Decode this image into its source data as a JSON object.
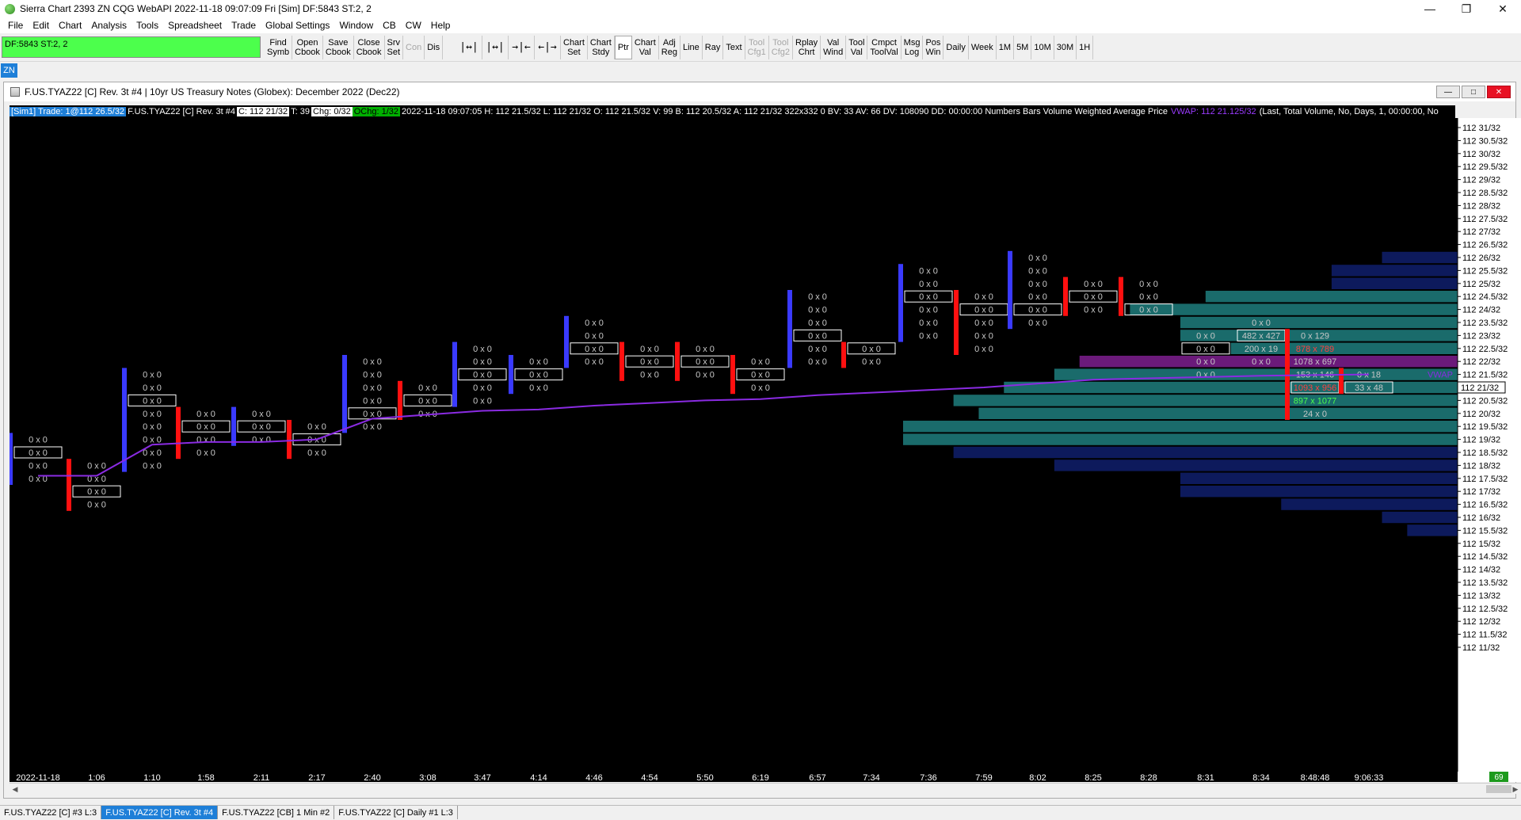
{
  "window": {
    "title": "Sierra Chart 2393 ZN  CQG WebAPI 2022-11-18  09:07:09 Fri [Sim]  DF:5843  ST:2, 2",
    "minimize": "—",
    "maximize": "❐",
    "close": "✕"
  },
  "menu": [
    "File",
    "Edit",
    "Chart",
    "Analysis",
    "Tools",
    "Spreadsheet",
    "Trade",
    "Global Settings",
    "Window",
    "CB",
    "CW",
    "Help"
  ],
  "toolbar": {
    "status": "DF:5843  ST:2, 2",
    "group1": [
      {
        "l1": "Find",
        "l2": "Symb",
        "disabled": false
      },
      {
        "l1": "Open",
        "l2": "Cbook",
        "disabled": false
      },
      {
        "l1": "Save",
        "l2": "Cbook",
        "disabled": false
      },
      {
        "l1": "Close",
        "l2": "Cbook",
        "disabled": false
      },
      {
        "l1": "Srv",
        "l2": "Set",
        "disabled": false
      },
      {
        "l1": "Con",
        "l2": "",
        "disabled": true
      },
      {
        "l1": "Dis",
        "l2": "",
        "disabled": false
      }
    ],
    "icons": [
      "|↔|",
      "|↔|",
      "→|←",
      "←|→"
    ],
    "group2": [
      {
        "l1": "Chart",
        "l2": "Set",
        "disabled": false
      },
      {
        "l1": "Chart",
        "l2": "Stdy",
        "disabled": false
      },
      {
        "l1": "Ptr",
        "l2": "",
        "disabled": false,
        "pressed": true
      },
      {
        "l1": "Chart",
        "l2": "Val",
        "disabled": false
      },
      {
        "l1": "Adj",
        "l2": "Reg",
        "disabled": false
      },
      {
        "l1": "Line",
        "l2": "",
        "disabled": false
      },
      {
        "l1": "Ray",
        "l2": "",
        "disabled": false
      },
      {
        "l1": "Text",
        "l2": "",
        "disabled": false
      },
      {
        "l1": "Tool",
        "l2": "Cfg1",
        "disabled": true
      },
      {
        "l1": "Tool",
        "l2": "Cfg2",
        "disabled": true
      },
      {
        "l1": "Rplay",
        "l2": "Chrt",
        "disabled": false
      },
      {
        "l1": "Val",
        "l2": "Wind",
        "disabled": false
      },
      {
        "l1": "Tool",
        "l2": "Val",
        "disabled": false
      },
      {
        "l1": "Cmpct",
        "l2": "ToolVal",
        "disabled": false
      },
      {
        "l1": "Msg",
        "l2": "Log",
        "disabled": false
      },
      {
        "l1": "Pos",
        "l2": "Win",
        "disabled": false
      },
      {
        "l1": "Daily",
        "l2": "",
        "disabled": false
      },
      {
        "l1": "Week",
        "l2": "",
        "disabled": false
      },
      {
        "l1": "1M",
        "l2": "",
        "disabled": false
      },
      {
        "l1": "5M",
        "l2": "",
        "disabled": false
      },
      {
        "l1": "10M",
        "l2": "",
        "disabled": false
      },
      {
        "l1": "30M",
        "l2": "",
        "disabled": false
      },
      {
        "l1": "1H",
        "l2": "",
        "disabled": false
      }
    ]
  },
  "symbol_tab": "ZN",
  "chart_window": {
    "title": "F.US.TYAZ22 [C]  Rev. 3t  #4 | 10yr US Treasury Notes (Globex): December 2022 (Dec22)",
    "min": "—",
    "max": "□",
    "close": "✕"
  },
  "info_bar": {
    "sim": "[Sim1]  Trade: 1@112 26.5/32",
    "sym": "F.US.TYAZ22 [C]  Rev. 3t  #4",
    "close": "C: 112 21/32",
    "t": "T: 39",
    "chg": "Chg: 0/32",
    "ochg": "OChg: 1/32",
    "rest": "2022-11-18 09:07:05  H: 112 21.5/32  L: 112 21/32  O: 112 21.5/32  V: 99  B: 112 20.5/32  A: 112 21/32  322x332  0  BV: 33  AV: 66  DV: 108090  DD: 00:00:00  Numbers Bars  Volume Weighted Average Price",
    "vwap": "VWAP: 112 21.125/32",
    "tail": "(Last, Total Volume, No, Days, 1, 00:00:00, No"
  },
  "colors": {
    "bg": "#000000",
    "up": "#3a3aff",
    "down": "#ff1010",
    "cell_text": "#c8c8c8",
    "box": "#ffffff",
    "vwap": "#8a2be2",
    "profile_blue": "#0d1a5c",
    "profile_teal": "#1a6b6b",
    "profile_poc": "#6b1a7a"
  },
  "chart_data": {
    "type": "numbers-bars",
    "y_labels": [
      "112 31/32",
      "112 30.5/32",
      "112 30/32",
      "112 29.5/32",
      "112 29/32",
      "112 28.5/32",
      "112 28/32",
      "112 27.5/32",
      "112 27/32",
      "112 26.5/32",
      "112 26/32",
      "112 25.5/32",
      "112 25/32",
      "112 24.5/32",
      "112 24/32",
      "112 23.5/32",
      "112 23/32",
      "112 22.5/32",
      "112 22/32",
      "112 21.5/32",
      "112 21/32",
      "112 20.5/32",
      "112 20/32",
      "112 19.5/32",
      "112 19/32",
      "112 18.5/32",
      "112 18/32",
      "112 17.5/32",
      "112 17/32",
      "112 16.5/32",
      "112 16/32",
      "112 15.5/32",
      "112 15/32",
      "112 14.5/32",
      "112 14/32",
      "112 13.5/32",
      "112 13/32",
      "112 12.5/32",
      "112 12/32",
      "112 11.5/32",
      "112 11/32"
    ],
    "current_price_label": "112 21/32",
    "vwap_label": "VWAP",
    "x_labels": [
      "2022-11-18",
      "1:06",
      "1:10",
      "1:58",
      "2:11",
      "2:17",
      "2:40",
      "3:08",
      "3:47",
      "4:14",
      "4:46",
      "4:54",
      "5:50",
      "6:19",
      "6:57",
      "7:34",
      "7:36",
      "7:59",
      "8:02",
      "8:25",
      "8:28",
      "8:31",
      "8:34",
      "8:48:48",
      "9:06:33"
    ],
    "cell_text": "0 x 0",
    "bars": [
      {
        "x": "2022-11-18",
        "high": 16,
        "low": 13,
        "box": 15,
        "dir": "up"
      },
      {
        "x": "1:06",
        "high": 14,
        "low": 11,
        "box": 12,
        "dir": "down"
      },
      {
        "x": "1:10",
        "high": 21,
        "low": 14,
        "box": 19,
        "dir": "up"
      },
      {
        "x": "1:58",
        "high": 18,
        "low": 15,
        "box": 17,
        "dir": "down"
      },
      {
        "x": "2:11",
        "high": 18,
        "low": 16,
        "box": 17,
        "dir": "up"
      },
      {
        "x": "2:17",
        "high": 17,
        "low": 15,
        "box": 16,
        "dir": "down"
      },
      {
        "x": "2:40",
        "high": 22,
        "low": 17,
        "box": 18,
        "dir": "up"
      },
      {
        "x": "3:08",
        "high": 20,
        "low": 18,
        "box": 19,
        "dir": "down"
      },
      {
        "x": "3:47",
        "high": 23,
        "low": 19,
        "box": 21,
        "dir": "up"
      },
      {
        "x": "4:14",
        "high": 22,
        "low": 20,
        "box": 21,
        "dir": "up"
      },
      {
        "x": "4:46",
        "high": 25,
        "low": 22,
        "box": 23,
        "dir": "up"
      },
      {
        "x": "4:54",
        "high": 23,
        "low": 21,
        "box": 22,
        "dir": "down"
      },
      {
        "x": "5:50",
        "high": 23,
        "low": 21,
        "box": 22,
        "dir": "down"
      },
      {
        "x": "6:19",
        "high": 22,
        "low": 20,
        "box": 21,
        "dir": "down"
      },
      {
        "x": "6:57",
        "high": 27,
        "low": 22,
        "box": 24,
        "dir": "up"
      },
      {
        "x": "7:34",
        "high": 23,
        "low": 22,
        "box": 23,
        "dir": "down"
      },
      {
        "x": "7:36",
        "high": 29,
        "low": 24,
        "box": 27,
        "dir": "up"
      },
      {
        "x": "7:59",
        "high": 27,
        "low": 23,
        "box": 26,
        "dir": "down"
      },
      {
        "x": "8:02",
        "high": 30,
        "low": 25,
        "box": 26,
        "dir": "up"
      },
      {
        "x": "8:25",
        "high": 28,
        "low": 26,
        "box": 27,
        "dir": "down"
      },
      {
        "x": "8:28",
        "high": 28,
        "low": 26,
        "box": 26,
        "dir": "down"
      }
    ],
    "right_bars": [
      {
        "x": "8:31",
        "rows": [
          {
            "y": 24,
            "t": "0 x 0",
            "box": false
          },
          {
            "y": 23,
            "t": "0 x 0",
            "box": true
          },
          {
            "y": 22,
            "t": "0 x 0",
            "box": false
          },
          {
            "y": 21,
            "t": "0 x 0",
            "box": false
          }
        ]
      },
      {
        "x": "8:34",
        "rows": [
          {
            "y": 25,
            "t": "0 x 0",
            "box": false
          },
          {
            "y": 24,
            "t": "482 x 427",
            "box": true
          },
          {
            "y": 23,
            "t": "200 x 19",
            "box": false
          },
          {
            "y": 22,
            "t": "0 x 0",
            "box": false
          }
        ]
      },
      {
        "x": "8:48:48",
        "rows": [
          {
            "y": 24,
            "t": "0 x 129",
            "box": false
          },
          {
            "y": 23,
            "t": "878 x 789",
            "box": false
          },
          {
            "y": 22,
            "t": "1078 x 697",
            "box": false
          },
          {
            "y": 21,
            "t": "153 x 146",
            "box": false
          },
          {
            "y": 20,
            "t": "1093 x 956",
            "box": true
          },
          {
            "y": 19,
            "t": "897 x 1077",
            "box": false
          },
          {
            "y": 18,
            "t": "24 x 0",
            "box": false
          }
        ]
      },
      {
        "x": "9:06:33",
        "rows": [
          {
            "y": 21,
            "t": "0 x 18",
            "box": false
          },
          {
            "y": 20,
            "t": "33 x 48",
            "box": true
          }
        ]
      }
    ],
    "volume_profile": [
      2,
      3,
      7,
      11,
      11,
      16,
      20,
      22,
      22,
      19,
      20,
      18,
      16,
      15,
      9,
      11,
      11,
      13,
      10,
      5,
      5,
      3
    ],
    "vwap": [
      13.2,
      13.2,
      15.6,
      15.8,
      15.8,
      16.0,
      17.6,
      17.9,
      18.2,
      18.3,
      18.6,
      18.8,
      19.0,
      19.1,
      19.4,
      19.6,
      19.8,
      20.0,
      20.3,
      20.6,
      20.7,
      20.8,
      20.9,
      20.95,
      21.0
    ]
  },
  "scroll": {
    "left": "◀",
    "right": "▶",
    "badge": "69"
  },
  "tabs": [
    {
      "label": "F.US.TYAZ22 [C]  #3 L:3",
      "active": false
    },
    {
      "label": "F.US.TYAZ22 [C]  Rev. 3t  #4",
      "active": true
    },
    {
      "label": "F.US.TYAZ22 [CB]  1 Min  #2",
      "active": false
    },
    {
      "label": "F.US.TYAZ22 [C]  Daily  #1 L:3",
      "active": false
    }
  ]
}
